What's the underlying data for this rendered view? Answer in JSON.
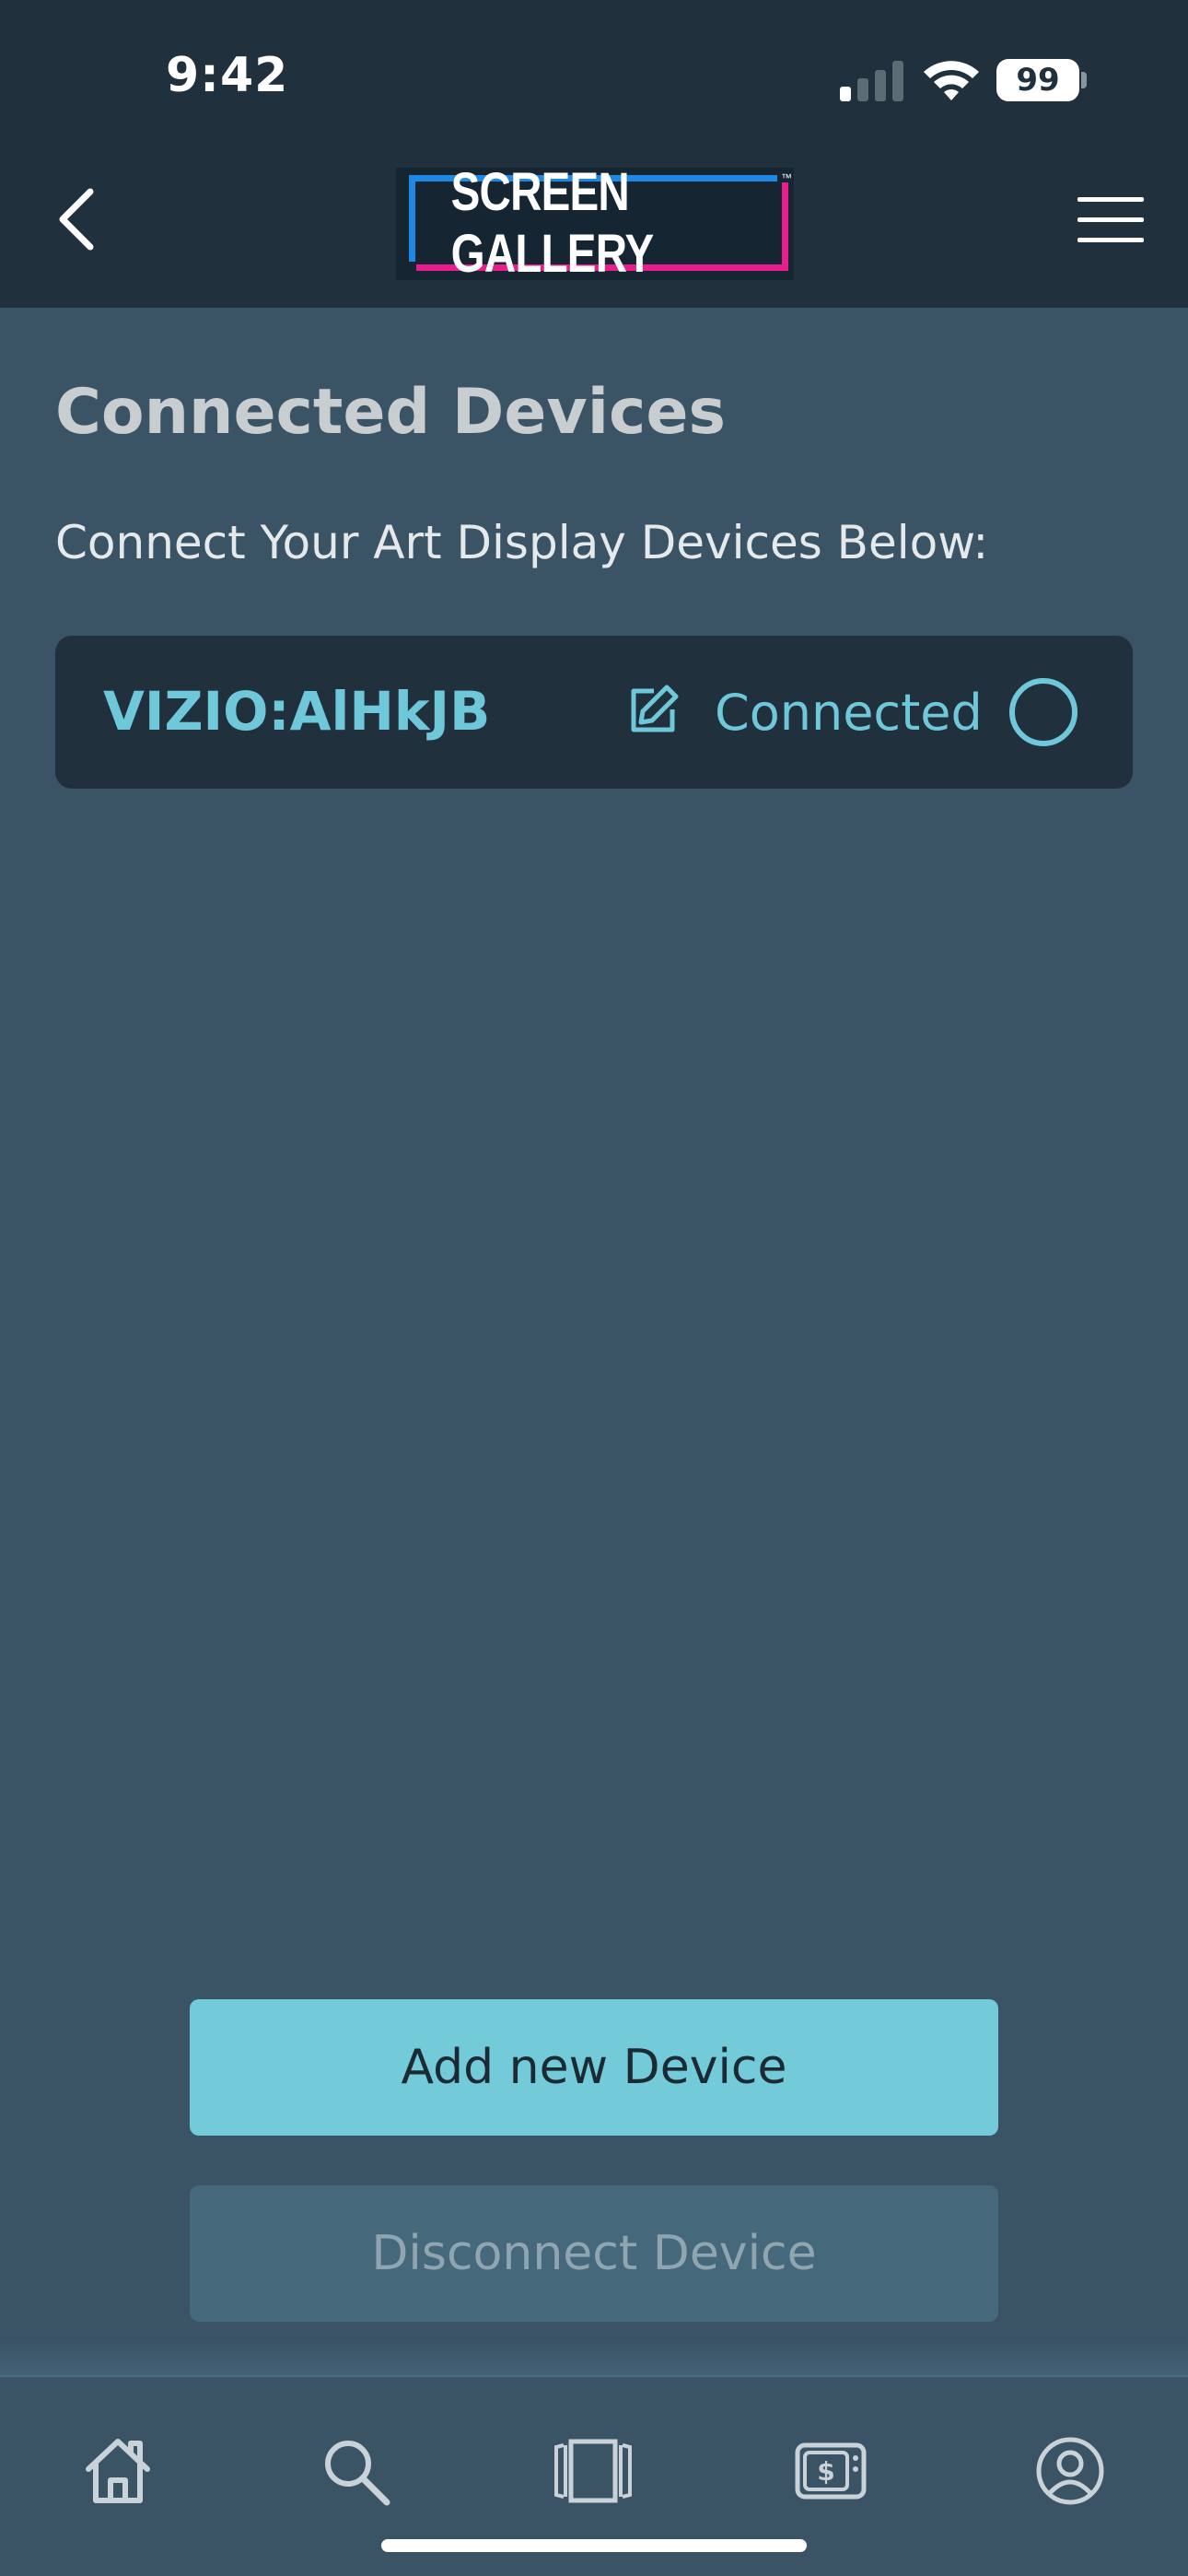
{
  "status_bar": {
    "time": "9:42",
    "battery": "99",
    "icons": [
      "signal-icon",
      "wifi-icon",
      "battery-icon"
    ]
  },
  "header": {
    "logo_text": "SCREEN GALLERY",
    "logo_tm": "™",
    "back_icon": "chevron-left-icon",
    "menu_icon": "hamburger-menu-icon"
  },
  "main": {
    "title": "Connected Devices",
    "subtitle": "Connect Your Art Display Devices Below:",
    "devices": [
      {
        "name": "VIZIO:AlHkJB",
        "status": "Connected",
        "edit_icon": "edit-icon",
        "selector_icon": "radio-circle-icon"
      }
    ]
  },
  "actions": {
    "add_label": "Add new Device",
    "disconnect_label": "Disconnect Device"
  },
  "tab_bar": {
    "tabs": [
      {
        "icon": "home-icon"
      },
      {
        "icon": "search-icon"
      },
      {
        "icon": "gallery-icon"
      },
      {
        "icon": "tv-purchase-icon"
      },
      {
        "icon": "profile-icon"
      }
    ]
  },
  "colors": {
    "background": "#3a5466",
    "header": "#20303c",
    "accent": "#73cad9",
    "card": "#20303c"
  }
}
